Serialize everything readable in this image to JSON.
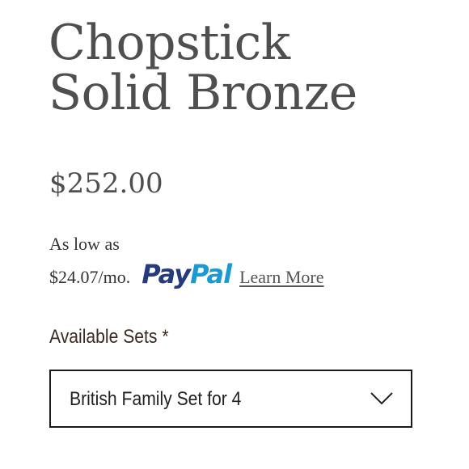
{
  "product": {
    "title_line1": "Chopstick",
    "title_line2": "Solid Bronze",
    "price": "$252.00"
  },
  "financing": {
    "intro": "As low as",
    "monthly": "$24.07/mo.",
    "brand_pay": "Pay",
    "brand_pal": "Pal",
    "learn_more": "Learn More"
  },
  "options": {
    "label": "Available Sets *",
    "selected": "British Family Set for 4",
    "icon": "chevron-down-icon"
  },
  "colors": {
    "paypal_dark": "#253b80",
    "paypal_light": "#179bd7",
    "label_brown": "#3d2a22"
  }
}
